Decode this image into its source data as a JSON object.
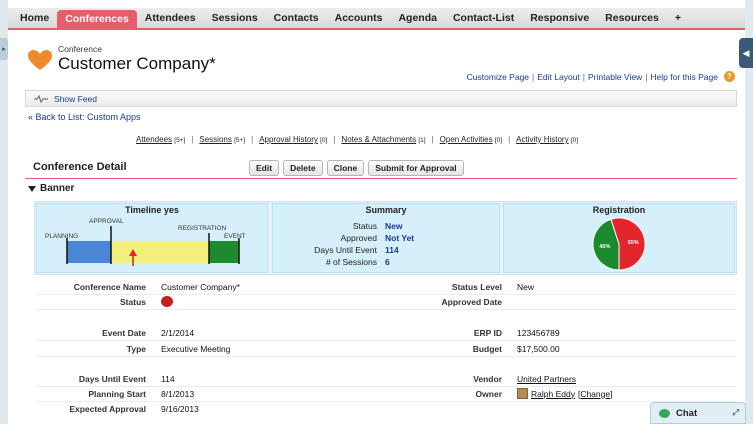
{
  "tabs": [
    {
      "label": "Home",
      "active": false
    },
    {
      "label": "Conferences",
      "active": true
    },
    {
      "label": "Attendees",
      "active": false
    },
    {
      "label": "Sessions",
      "active": false
    },
    {
      "label": "Contacts",
      "active": false
    },
    {
      "label": "Accounts",
      "active": false
    },
    {
      "label": "Agenda",
      "active": false
    },
    {
      "label": "Contact-List",
      "active": false
    },
    {
      "label": "Responsive",
      "active": false
    },
    {
      "label": "Resources",
      "active": false
    },
    {
      "label": "+",
      "active": false
    }
  ],
  "header": {
    "object_type": "Conference",
    "record_name": "Customer Company*"
  },
  "page_links": {
    "customize": "Customize Page",
    "edit_layout": "Edit Layout",
    "printable": "Printable View",
    "help": "Help for this Page",
    "sep": "|",
    "help_icon": "?"
  },
  "feed": {
    "label": "Show Feed"
  },
  "back_link": "« Back to List: Custom Apps",
  "related": [
    {
      "label": "Attendees",
      "count": "[5+]"
    },
    {
      "label": "Sessions",
      "count": "[5+]"
    },
    {
      "label": "Approval History",
      "count": "[0]"
    },
    {
      "label": "Notes & Attachments",
      "count": "[1]"
    },
    {
      "label": "Open Activities",
      "count": "[0]"
    },
    {
      "label": "Activity History",
      "count": "[0]"
    }
  ],
  "detail": {
    "title": "Conference Detail",
    "buttons": {
      "edit": "Edit",
      "delete": "Delete",
      "clone": "Clone",
      "submit": "Submit for Approval"
    }
  },
  "banner": {
    "title": "Banner",
    "timeline": {
      "title": "Timeline yes",
      "labels": {
        "planning": "PLANNING",
        "approval": "APPROVAL",
        "registration": "REGISTRATION",
        "event": "EVENT"
      },
      "colors": {
        "planning": "#4a86d6",
        "approval": "#f4ef7a",
        "event": "#1d8a2e",
        "marker": "#e0262b"
      }
    },
    "summary": {
      "title": "Summary",
      "rows": [
        {
          "k": "Status",
          "v": "New"
        },
        {
          "k": "Approved",
          "v": "Not Yet"
        },
        {
          "k": "Days Until Event",
          "v": "114"
        },
        {
          "k": "# of Sessions",
          "v": "6"
        }
      ]
    },
    "registration": {
      "title": "Registration",
      "slices": [
        {
          "label": "45%",
          "value": 45,
          "color": "#1b8a2f"
        },
        {
          "label": "55%",
          "value": 55,
          "color": "#e4252d"
        }
      ]
    }
  },
  "fields": {
    "conference_name": {
      "label": "Conference Name",
      "value": "Customer Company*"
    },
    "status_level": {
      "label": "Status Level",
      "value": "New"
    },
    "status": {
      "label": "Status",
      "dot_color": "#c41e1e"
    },
    "approved_date": {
      "label": "Approved Date",
      "value": ""
    },
    "event_date": {
      "label": "Event Date",
      "value": "2/1/2014"
    },
    "erp_id": {
      "label": "ERP ID",
      "value": "123456789"
    },
    "type": {
      "label": "Type",
      "value": "Executive Meeting"
    },
    "budget": {
      "label": "Budget",
      "value": "$17,500.00"
    },
    "days_until": {
      "label": "Days Until Event",
      "value": "114"
    },
    "vendor": {
      "label": "Vendor",
      "value": "United Partners"
    },
    "planning_start": {
      "label": "Planning Start",
      "value": "8/1/2013"
    },
    "owner": {
      "label": "Owner",
      "value": "Ralph Eddy",
      "change": "[Change]"
    },
    "expected_approval": {
      "label": "Expected Approval",
      "value": "9/16/2013"
    }
  },
  "chat": {
    "label": "Chat"
  }
}
